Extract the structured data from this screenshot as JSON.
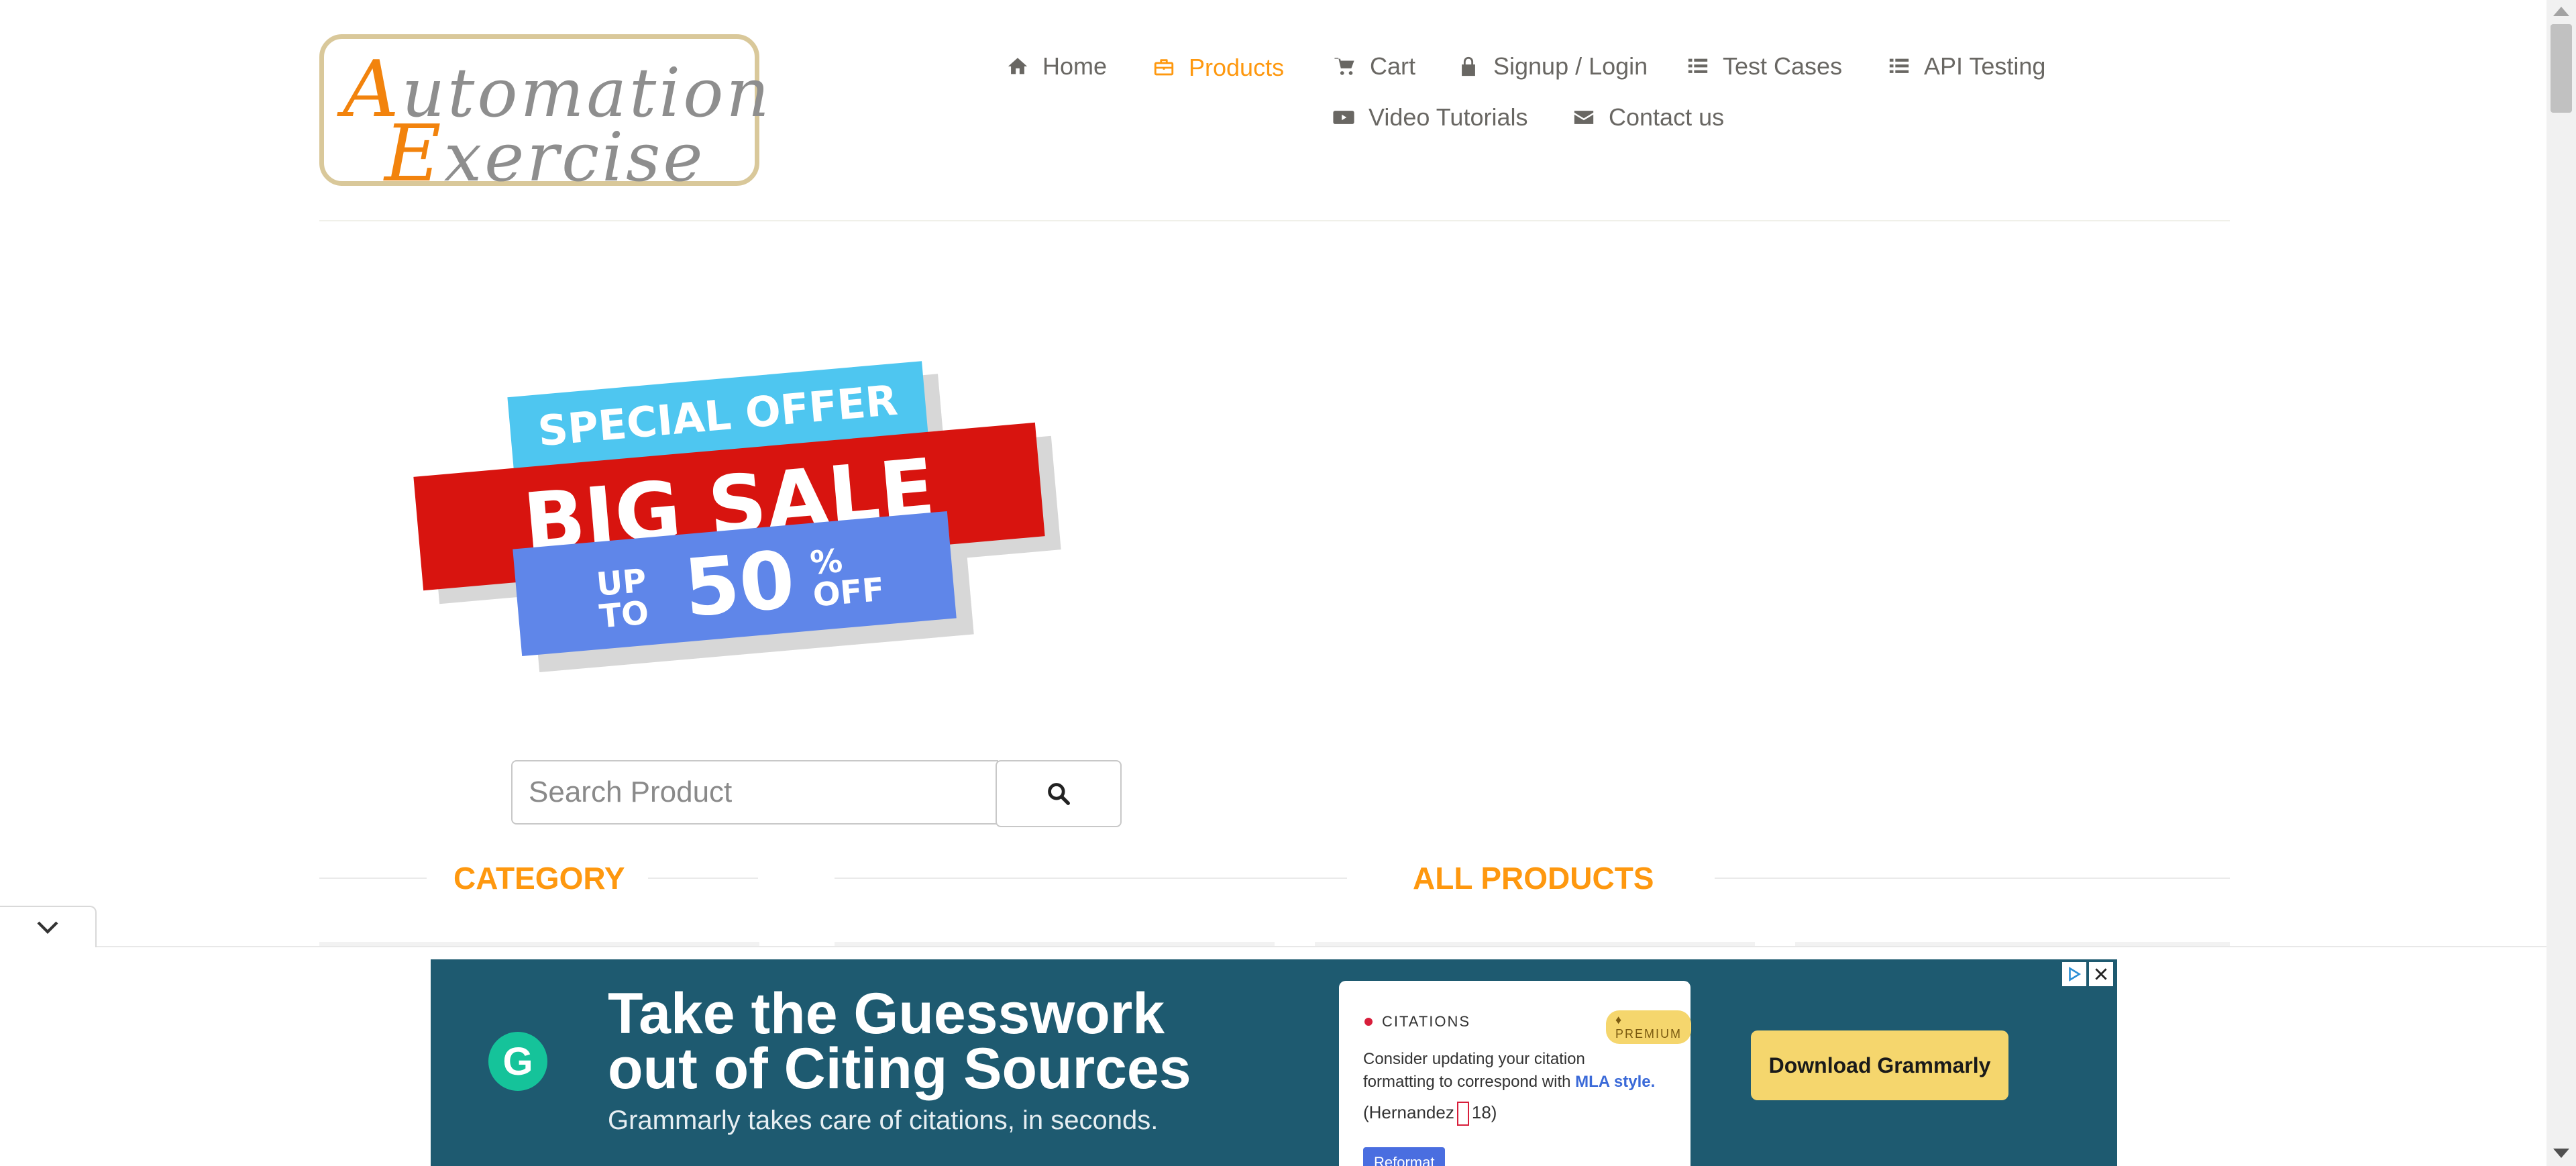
{
  "logo": {
    "line1_cap": "A",
    "line1_rest": "utomation",
    "line2_cap": "E",
    "line2_rest": "xercise"
  },
  "nav": [
    {
      "label": "Home",
      "icon": "home-icon"
    },
    {
      "label": "Products",
      "icon": "briefcase-icon",
      "active": true
    },
    {
      "label": "Cart",
      "icon": "cart-icon"
    },
    {
      "label": "Signup / Login",
      "icon": "lock-icon"
    },
    {
      "label": "Test Cases",
      "icon": "list-icon"
    },
    {
      "label": "API Testing",
      "icon": "list-icon"
    },
    {
      "label": "Video Tutorials",
      "icon": "youtube-play-icon"
    },
    {
      "label": "Contact us",
      "icon": "envelope-icon"
    }
  ],
  "banner": {
    "special": "SPECIAL OFFER",
    "sale": "BIG SALE",
    "up": "UP",
    "to": "TO",
    "percent": "50",
    "pct_sign": "%",
    "off": "OFF"
  },
  "search": {
    "placeholder": "Search Product",
    "value": ""
  },
  "sections": {
    "category": "CATEGORY",
    "all_products": "ALL PRODUCTS"
  },
  "ad": {
    "headline_1": "Take the Guesswork",
    "headline_2": "out of Citing Sources",
    "subline": "Grammarly takes care of citations, in seconds.",
    "card_title": "CITATIONS",
    "premium": "PREMIUM",
    "card_text_1": "Consider updating your citation formatting to correspond with",
    "card_text_link": "MLA style.",
    "citation_left": "(Hernandez",
    "citation_right": "18)",
    "reformat_label": "Reformat",
    "cta": "Download Grammarly"
  },
  "colors": {
    "accent": "#fe980f",
    "ad_bg": "#1e5a70",
    "ad_cta": "#f5d66d"
  }
}
